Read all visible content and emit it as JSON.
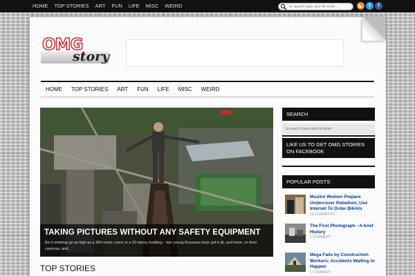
{
  "top_nav": {
    "items": [
      "HOME",
      "TOP STORIES",
      "ART",
      "FUN",
      "LIFE",
      "MISC",
      "WEIRD"
    ]
  },
  "top_search": {
    "placeholder": "to search type and hit enter ..."
  },
  "socials": [
    {
      "name": "rss-icon",
      "glyph": "◣",
      "color": "#f08a24"
    },
    {
      "name": "twitter-icon",
      "glyph": "t",
      "color": "#2aa9e0"
    },
    {
      "name": "facebook-icon",
      "glyph": "f",
      "color": "#3b5998"
    }
  ],
  "logo": {
    "part1": "OMG",
    "part2": "story"
  },
  "main_nav": {
    "items": [
      "HOME",
      "TOP STORIES",
      "ART",
      "FUN",
      "LIFE",
      "MISC",
      "WEIRD"
    ]
  },
  "featured": {
    "title": "TAKING PICTURES WITHOUT ANY SAFETY EQUIPMENT",
    "excerpt": "Be it climbing up as high as a 360-meter crane or a 22-storey building – two young Russians have got it all, and more, on their cameras, and..."
  },
  "section": {
    "top_stories": "TOP STORIES"
  },
  "sidebar": {
    "search_title": "SEARCH",
    "search_placeholder": "to search type and hit enter",
    "like_title": "LIKE US TO GET OMG STORIES ON FACEBOOK",
    "popular_title": "POPULAR POSTS",
    "posts": [
      {
        "title": "Muslim Women Prepare Undercover Rebellion; Use Internet To Order Bikinis",
        "meta": "19 COMMENTS"
      },
      {
        "title": "The First Photograph - A brief History",
        "meta": "1 COMMENT"
      },
      {
        "title": "Mega Fails by Construction Workers: Accidents Waiting to Happen",
        "meta": "1 COMMENT"
      }
    ]
  }
}
